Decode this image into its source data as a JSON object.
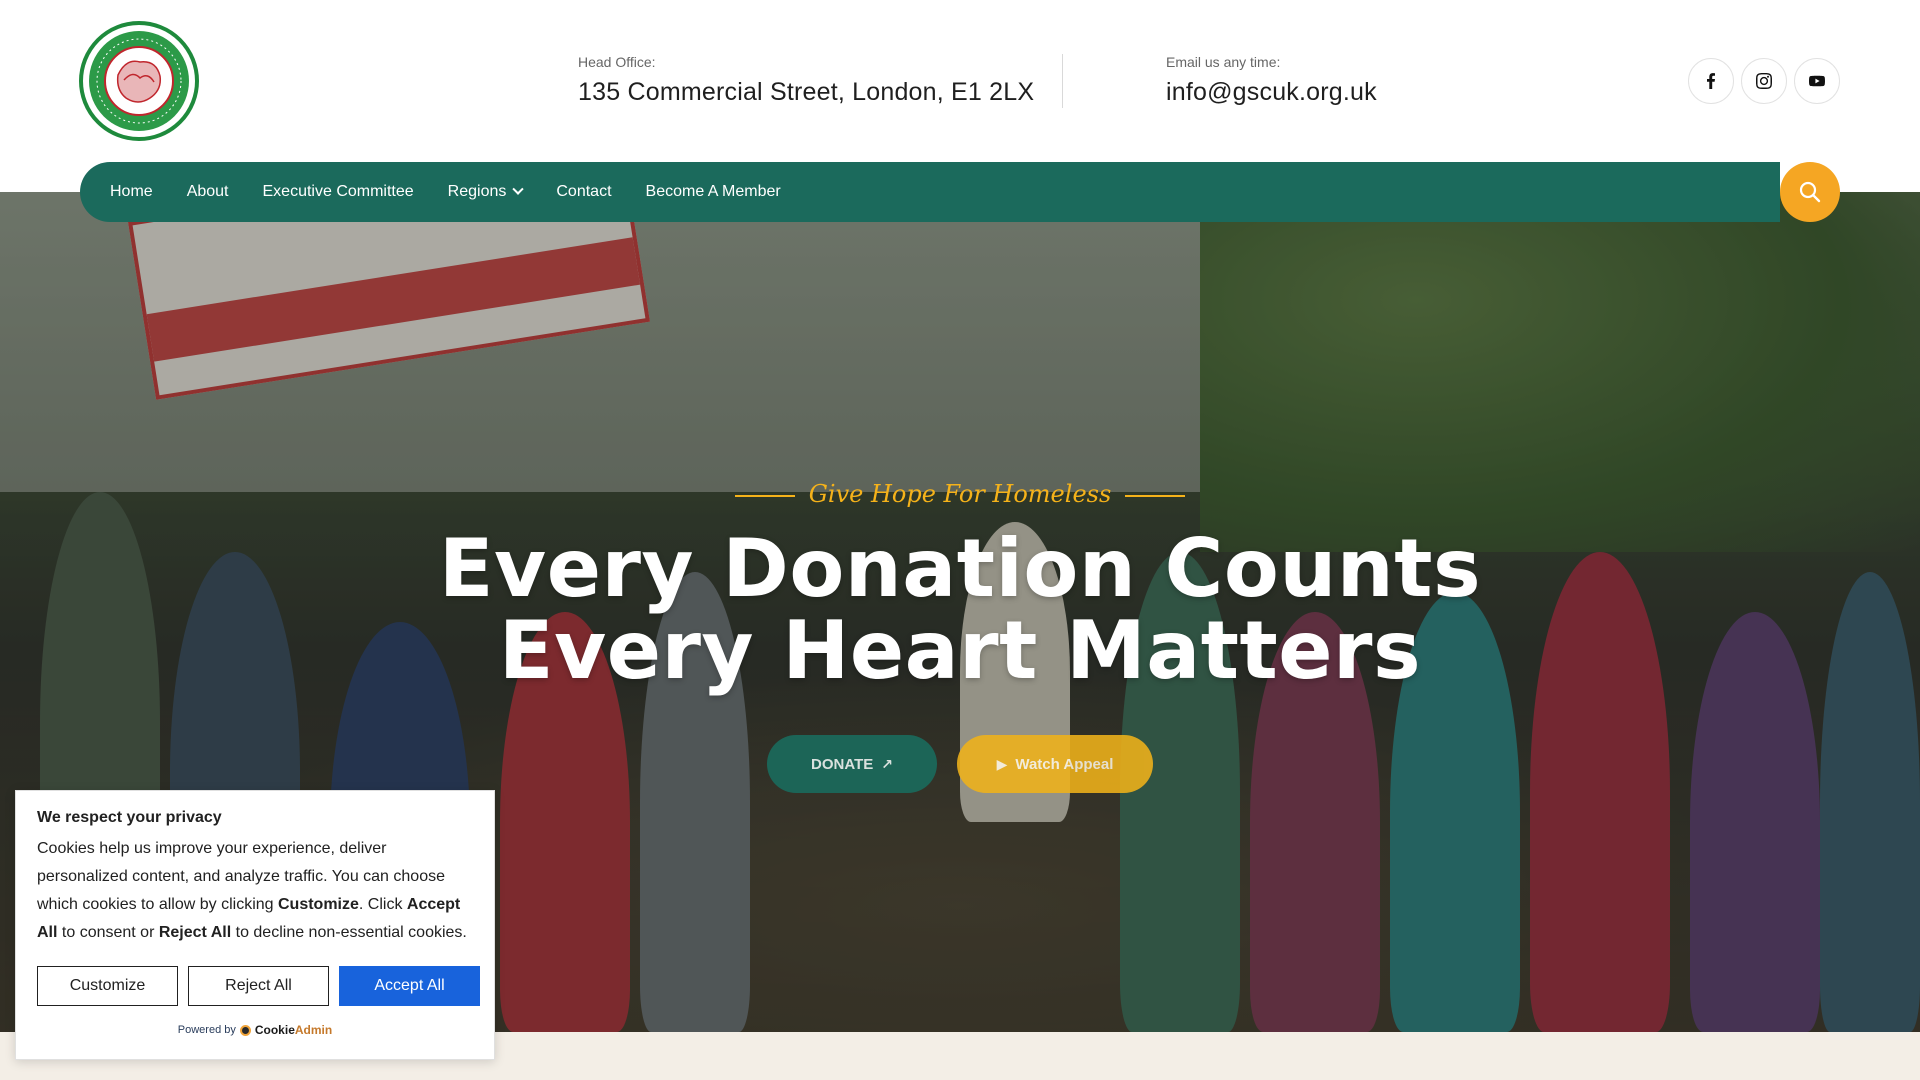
{
  "header": {
    "logo_alt": "Greater Sylhet Development and Welfare Council in UK",
    "address_label": "Head Office:",
    "address_value": "135 Commercial Street, London, E1 2LX",
    "email_label": "Email us any time:",
    "email_value": "info@gscuk.org.uk",
    "social": [
      {
        "name": "facebook",
        "icon": "facebook-icon"
      },
      {
        "name": "instagram",
        "icon": "instagram-icon"
      },
      {
        "name": "youtube",
        "icon": "youtube-icon"
      }
    ]
  },
  "nav": {
    "items": [
      {
        "label": "Home"
      },
      {
        "label": "About"
      },
      {
        "label": "Executive Committee"
      },
      {
        "label": "Regions",
        "has_dropdown": true
      },
      {
        "label": "Contact"
      },
      {
        "label": "Become A Member"
      }
    ],
    "search_icon": "search-icon"
  },
  "hero": {
    "tagline": "Give Hope For Homeless",
    "headline_line1": "Every Donation Counts",
    "headline_line2": "Every Heart Matters",
    "donate_label": "DONATE",
    "appeal_label": "Watch Appeal"
  },
  "cookie": {
    "title": "We respect your privacy",
    "text_1": "Cookies help us improve your experience, deliver personalized content, and analyze traffic. You can choose which cookies to allow by clicking ",
    "text_customize": "Customize",
    "text_2": ". Click ",
    "text_accept": "Accept All",
    "text_3": " to consent or ",
    "text_reject": "Reject All",
    "text_4": " to decline non-essential cookies.",
    "customize_label": "Customize",
    "reject_label": "Reject All",
    "accept_label": "Accept All",
    "powered_by": "Powered by",
    "brand_cookie": "Cookie",
    "brand_admin": "Admin"
  },
  "colors": {
    "primary": "#1b6a5c",
    "accent": "#f5a623",
    "accept_button": "#1863dc"
  }
}
